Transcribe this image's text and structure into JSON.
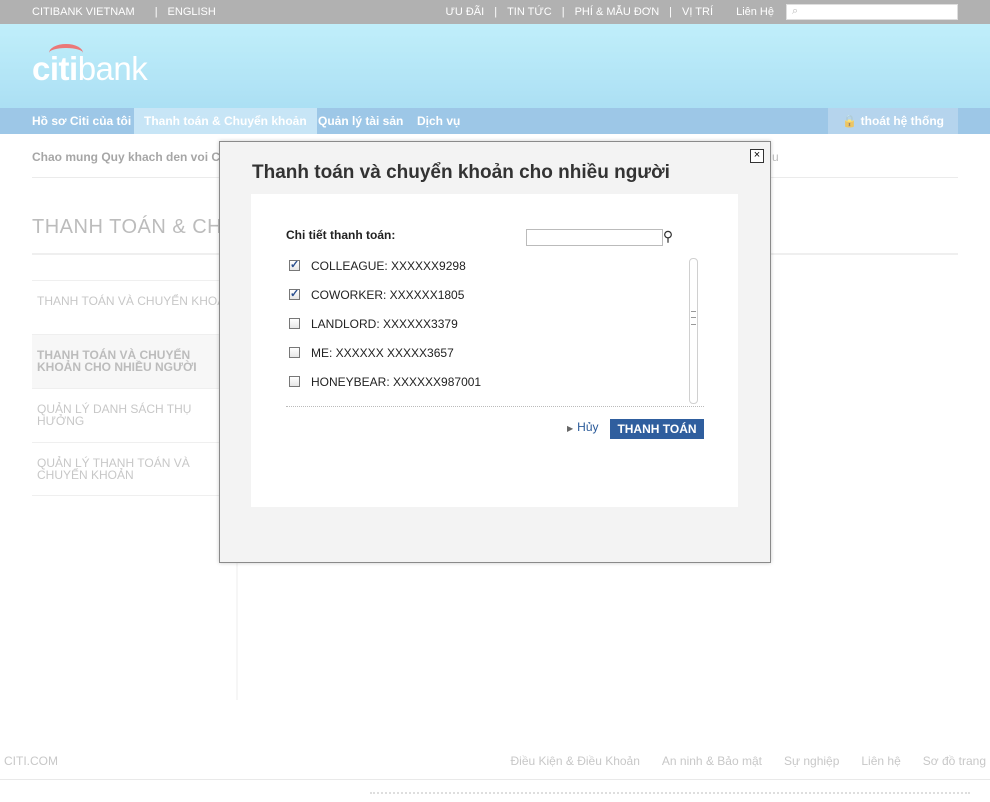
{
  "topbar": {
    "left": [
      "CITIBANK VIETNAM",
      "ENGLISH"
    ],
    "right": [
      "ƯU ĐÃI",
      "TIN TỨC",
      "PHÍ & MẪU ĐƠN",
      "VỊ TRÍ",
      "Liên Hệ"
    ],
    "search_placeholder": ""
  },
  "header": {
    "logo_citi": "citi",
    "logo_bank": "bank"
  },
  "nav": {
    "items": [
      "Hồ sơ Citi của tôi",
      "Thanh toán & Chuyển khoản",
      "Quản lý tài sản",
      "Dịch vụ"
    ],
    "active_index": 1,
    "logout": "thoát hệ thống"
  },
  "page": {
    "welcome": "Chao mung Quy khach den voi Ci",
    "welcome_tail": "u",
    "section_title": "THANH TOÁN & CHU",
    "side_menu": [
      "THANH TOÁN VÀ CHUYỂN KHOẢN",
      "THANH TOÁN VÀ CHUYỂN KHOẢN CHO NHIỀU NGƯỜI",
      "QUẢN LÝ DANH SÁCH THỤ HƯỞNG",
      "QUẢN LÝ THANH TOÁN VÀ CHUYỂN KHOẢN"
    ],
    "side_active_index": 1
  },
  "footer": {
    "left": "CITI.COM",
    "links": [
      "Điều Kiện & Điều Khoản",
      "An ninh & Bảo mật",
      "Sự nghiệp",
      "Liên hệ",
      "Sơ đồ trang"
    ]
  },
  "modal": {
    "close": "×",
    "title": "Thanh toán và chuyển khoản cho nhiều người",
    "label": "Chi tiết thanh toán:",
    "search_value": "",
    "payees": [
      {
        "text": "COLLEAGUE: XXXXXX9298",
        "checked": true
      },
      {
        "text": "COWORKER: XXXXXX1805",
        "checked": true
      },
      {
        "text": "LANDLORD: XXXXXX3379",
        "checked": false
      },
      {
        "text": "ME: XXXXXX XXXXX3657",
        "checked": false
      },
      {
        "text": "HONEYBEAR: XXXXXX987001",
        "checked": false
      }
    ],
    "cancel": "Hủy",
    "pay": "THANH TOÁN"
  },
  "colors": {
    "topbar": "#888888",
    "header": "#8fd8f3",
    "nav": "#69aadb",
    "pay_button": "#2f5e9e",
    "logo_arc": "#e02f30"
  }
}
